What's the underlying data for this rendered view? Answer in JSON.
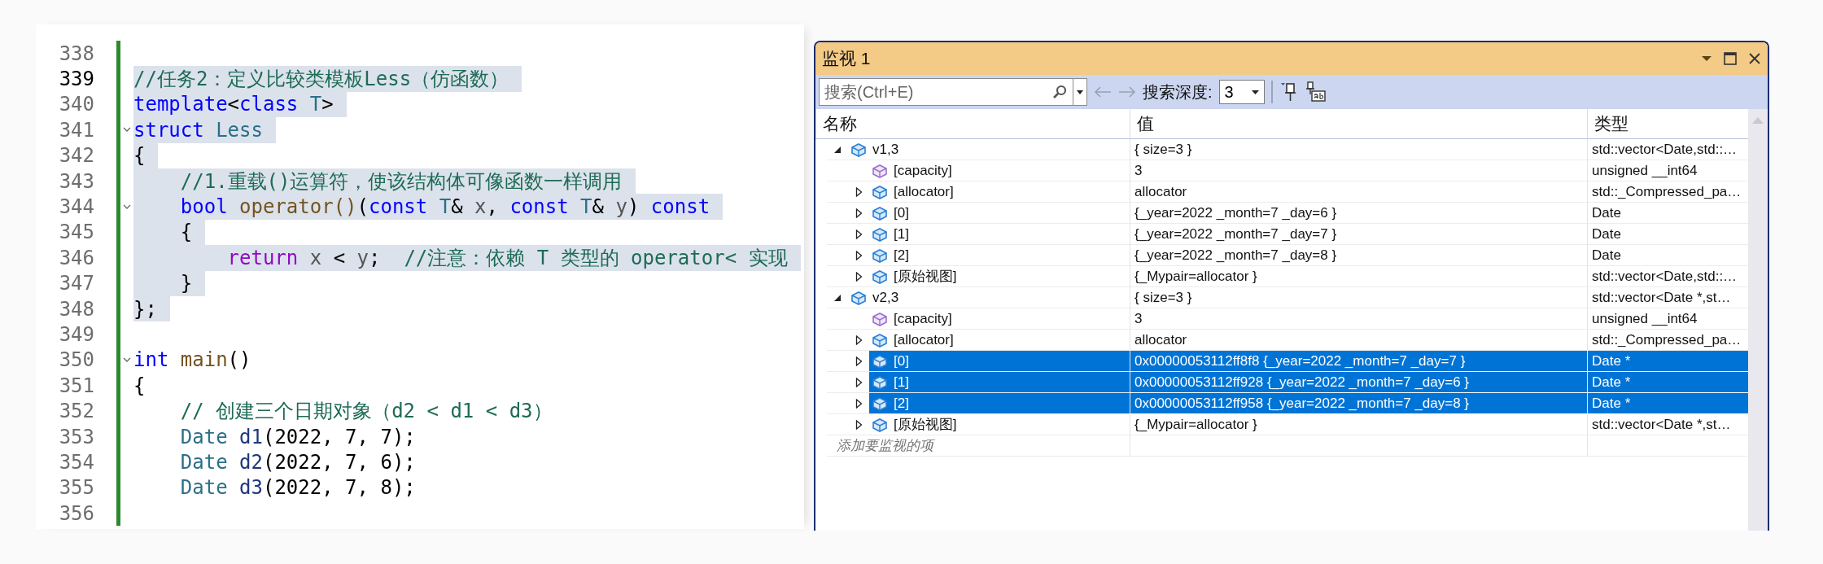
{
  "editor": {
    "lines": [
      {
        "number": "338",
        "current": false,
        "fold": false
      },
      {
        "number": "339",
        "current": true,
        "highlighted": true,
        "fold": false,
        "tokens": [
          {
            "kind": "comment",
            "text": "//任务2：定义比较类模板Less（仿函数）"
          }
        ]
      },
      {
        "number": "340",
        "current": false,
        "highlighted": true,
        "fold": false,
        "tokens": [
          {
            "kind": "keyword",
            "text": "template"
          },
          {
            "kind": "plain",
            "text": "<"
          },
          {
            "kind": "keyword",
            "text": "class"
          },
          {
            "kind": "type",
            "text": " T"
          },
          {
            "kind": "plain",
            "text": ">"
          }
        ]
      },
      {
        "number": "341",
        "current": false,
        "highlighted": true,
        "fold": true,
        "tokens": [
          {
            "kind": "keyword",
            "text": "struct"
          },
          {
            "kind": "type",
            "text": " Less"
          }
        ]
      },
      {
        "number": "342",
        "current": false,
        "highlighted": true,
        "fold": false,
        "tokens": [
          {
            "kind": "plain",
            "text": "{"
          }
        ]
      },
      {
        "number": "343",
        "current": false,
        "highlighted": true,
        "fold": false,
        "tokens": [
          {
            "kind": "comment",
            "text": "    //1.重载()运算符，使该结构体可像函数一样调用"
          }
        ]
      },
      {
        "number": "344",
        "current": false,
        "highlighted": true,
        "fold": true,
        "tokens": [
          {
            "kind": "keyword",
            "text": "    bool"
          },
          {
            "kind": "func",
            "text": " operator()"
          },
          {
            "kind": "plain",
            "text": "("
          },
          {
            "kind": "keyword",
            "text": "const"
          },
          {
            "kind": "type",
            "text": " T"
          },
          {
            "kind": "plain",
            "text": "& "
          },
          {
            "kind": "param",
            "text": "x"
          },
          {
            "kind": "plain",
            "text": ", "
          },
          {
            "kind": "keyword",
            "text": "const"
          },
          {
            "kind": "type",
            "text": " T"
          },
          {
            "kind": "plain",
            "text": "& "
          },
          {
            "kind": "param",
            "text": "y"
          },
          {
            "kind": "plain",
            "text": ") "
          },
          {
            "kind": "keyword",
            "text": "const"
          }
        ]
      },
      {
        "number": "345",
        "current": false,
        "highlighted": true,
        "fold": false,
        "tokens": [
          {
            "kind": "plain",
            "text": "    {"
          }
        ]
      },
      {
        "number": "346",
        "current": false,
        "highlighted": true,
        "fold": false,
        "tokens": [
          {
            "kind": "control",
            "text": "        return"
          },
          {
            "kind": "param",
            "text": " x"
          },
          {
            "kind": "plain",
            "text": " < "
          },
          {
            "kind": "param",
            "text": "y"
          },
          {
            "kind": "plain",
            "text": ";  "
          },
          {
            "kind": "comment",
            "text": "//注意：依赖 T 类型的 operator< 实现"
          }
        ]
      },
      {
        "number": "347",
        "current": false,
        "highlighted": true,
        "fold": false,
        "tokens": [
          {
            "kind": "plain",
            "text": "    }"
          }
        ]
      },
      {
        "number": "348",
        "current": false,
        "highlighted": true,
        "fold": false,
        "tokens": [
          {
            "kind": "plain",
            "text": "};"
          }
        ]
      },
      {
        "number": "349",
        "current": false,
        "fold": false
      },
      {
        "number": "350",
        "current": false,
        "highlighted": false,
        "fold": true,
        "tokens": [
          {
            "kind": "keyword",
            "text": "int"
          },
          {
            "kind": "func",
            "text": " main"
          },
          {
            "kind": "plain",
            "text": "()"
          }
        ]
      },
      {
        "number": "351",
        "current": false,
        "highlighted": false,
        "fold": false,
        "tokens": [
          {
            "kind": "plain",
            "text": "{"
          }
        ]
      },
      {
        "number": "352",
        "current": false,
        "highlighted": false,
        "fold": false,
        "tokens": [
          {
            "kind": "comment",
            "text": "    // 创建三个日期对象（d2 < d1 < d3）"
          }
        ]
      },
      {
        "number": "353",
        "current": false,
        "highlighted": false,
        "fold": false,
        "tokens": [
          {
            "kind": "type",
            "text": "    Date"
          },
          {
            "kind": "var",
            "text": " d1"
          },
          {
            "kind": "plain",
            "text": "(2022, 7, 7);"
          }
        ]
      },
      {
        "number": "354",
        "current": false,
        "highlighted": false,
        "fold": false,
        "tokens": [
          {
            "kind": "type",
            "text": "    Date"
          },
          {
            "kind": "var",
            "text": " d2"
          },
          {
            "kind": "plain",
            "text": "(2022, 7, 6);"
          }
        ]
      },
      {
        "number": "355",
        "current": false,
        "highlighted": false,
        "fold": false,
        "tokens": [
          {
            "kind": "type",
            "text": "    Date"
          },
          {
            "kind": "var",
            "text": " d3"
          },
          {
            "kind": "plain",
            "text": "(2022, 7, 8);"
          }
        ]
      },
      {
        "number": "356",
        "current": false,
        "fold": false
      }
    ]
  },
  "watch": {
    "title": "监视 1",
    "search": {
      "placeholder": "搜索(Ctrl+E)"
    },
    "depth_label": "搜索深度:",
    "depth_value": "3",
    "columns": [
      "名称",
      "值",
      "类型"
    ],
    "rows": [
      {
        "name": "v1,3",
        "value": "{ size=3 }",
        "type": "std::vector<Date,std::…",
        "kind": "object",
        "expanded": true,
        "selected": false,
        "children": [
          {
            "name": "[capacity]",
            "value": "3",
            "type": "unsigned __int64",
            "kind": "value",
            "selected": false
          },
          {
            "name": "[allocator]",
            "value": "allocator",
            "type": "std::_Compressed_pa…",
            "kind": "object",
            "expanded": false,
            "selected": false
          },
          {
            "name": "[0]",
            "value": "{_year=2022 _month=7 _day=6 }",
            "type": "Date",
            "kind": "object",
            "expanded": false,
            "selected": false
          },
          {
            "name": "[1]",
            "value": "{_year=2022 _month=7 _day=7 }",
            "type": "Date",
            "kind": "object",
            "expanded": false,
            "selected": false
          },
          {
            "name": "[2]",
            "value": "{_year=2022 _month=7 _day=8 }",
            "type": "Date",
            "kind": "object",
            "expanded": false,
            "selected": false
          },
          {
            "name": "[原始视图]",
            "value": "{_Mypair=allocator }",
            "type": "std::vector<Date,std::…",
            "kind": "object",
            "expanded": false,
            "selected": false
          }
        ]
      },
      {
        "name": "v2,3",
        "value": "{ size=3 }",
        "type": "std::vector<Date *,st…",
        "kind": "object",
        "expanded": true,
        "selected": false,
        "children": [
          {
            "name": "[capacity]",
            "value": "3",
            "type": "unsigned __int64",
            "kind": "value",
            "selected": false
          },
          {
            "name": "[allocator]",
            "value": "allocator",
            "type": "std::_Compressed_pa…",
            "kind": "object",
            "expanded": false,
            "selected": false
          },
          {
            "name": "[0]",
            "value": "0x00000053112ff8f8 {_year=2022 _month=7 _day=7 }",
            "type": "Date *",
            "kind": "object",
            "expanded": false,
            "selected": true
          },
          {
            "name": "[1]",
            "value": "0x00000053112ff928 {_year=2022 _month=7 _day=6 }",
            "type": "Date *",
            "kind": "object",
            "expanded": false,
            "selected": true
          },
          {
            "name": "[2]",
            "value": "0x00000053112ff958 {_year=2022 _month=7 _day=8 }",
            "type": "Date *",
            "kind": "object",
            "expanded": false,
            "selected": true
          },
          {
            "name": "[原始视图]",
            "value": "{_Mypair=allocator }",
            "type": "std::vector<Date *,st…",
            "kind": "object",
            "expanded": false,
            "selected": false
          }
        ]
      }
    ],
    "add_item_placeholder": "添加要监视的项"
  }
}
